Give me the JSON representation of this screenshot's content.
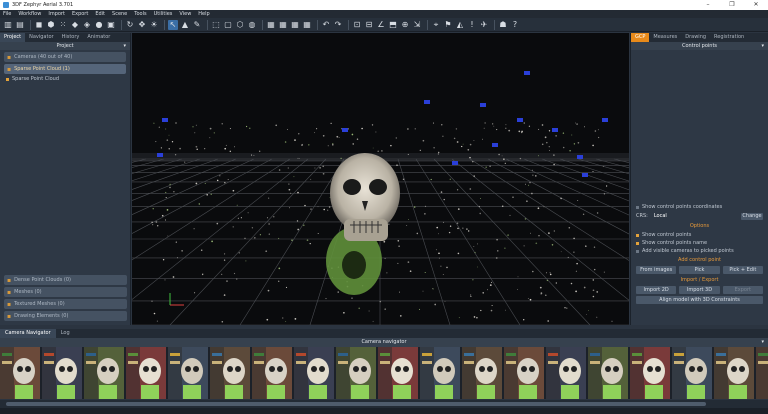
{
  "window": {
    "title": "3DF Zephyr Aerial 3.701",
    "controls": [
      "–",
      "❐",
      "✕"
    ]
  },
  "menu": [
    "File",
    "Workflow",
    "Import",
    "Export",
    "Edit",
    "Scene",
    "Tools",
    "Utilities",
    "View",
    "Help"
  ],
  "toolbar_icons": [
    {
      "name": "open-icon",
      "glyph": "▥"
    },
    {
      "name": "save-icon",
      "glyph": "▤"
    },
    {
      "name": "cube-solid-icon",
      "glyph": "◼"
    },
    {
      "name": "cube-wire-icon",
      "glyph": "⬢"
    },
    {
      "name": "points-icon",
      "glyph": "⁙"
    },
    {
      "name": "mesh-icon",
      "glyph": "◆"
    },
    {
      "name": "textured-icon",
      "glyph": "◈"
    },
    {
      "name": "sphere-icon",
      "glyph": "●"
    },
    {
      "name": "camera-icon",
      "glyph": "▣"
    },
    {
      "name": "orbit-icon",
      "glyph": "↻"
    },
    {
      "name": "pan-icon",
      "glyph": "✥"
    },
    {
      "name": "light-icon",
      "glyph": "☀"
    },
    {
      "name": "select-icon",
      "glyph": "↖"
    },
    {
      "name": "triangle-icon",
      "glyph": "▲"
    },
    {
      "name": "paint-icon",
      "glyph": "✎"
    },
    {
      "name": "lasso-icon",
      "glyph": "⬚"
    },
    {
      "name": "box-select-icon",
      "glyph": "▢"
    },
    {
      "name": "cube-icon",
      "glyph": "⬡"
    },
    {
      "name": "sphere2-icon",
      "glyph": "◍"
    },
    {
      "name": "grid1-icon",
      "glyph": "▦"
    },
    {
      "name": "grid2-icon",
      "glyph": "▦"
    },
    {
      "name": "grid3-icon",
      "glyph": "▦"
    },
    {
      "name": "grid4-icon",
      "glyph": "▦"
    },
    {
      "name": "undo-icon",
      "glyph": "↶"
    },
    {
      "name": "redo-icon",
      "glyph": "↷"
    },
    {
      "name": "measure-icon",
      "glyph": "⊡"
    },
    {
      "name": "ruler-icon",
      "glyph": "⊟"
    },
    {
      "name": "angle-icon",
      "glyph": "∠"
    },
    {
      "name": "area-icon",
      "glyph": "⬒"
    },
    {
      "name": "gcp-icon",
      "glyph": "⊕"
    },
    {
      "name": "scale-icon",
      "glyph": "⇲"
    },
    {
      "name": "tower-icon",
      "glyph": "⌖"
    },
    {
      "name": "flag-icon",
      "glyph": "⚑"
    },
    {
      "name": "cone-icon",
      "glyph": "◭"
    },
    {
      "name": "exclaim-icon",
      "glyph": "!"
    },
    {
      "name": "drone-icon",
      "glyph": "✈"
    },
    {
      "name": "mask-icon",
      "glyph": "☗"
    },
    {
      "name": "help-icon",
      "glyph": "?"
    }
  ],
  "left_panel": {
    "tabs": [
      "Project",
      "Navigator",
      "History",
      "Animator"
    ],
    "title": "Project",
    "cameras_button": "Cameras (40 out of 40)",
    "sparse_button": "Sparse Point Cloud (1)",
    "tree_item": "Sparse Point Cloud",
    "bottom_items": [
      "Dense Point Clouds (0)",
      "Meshes (0)",
      "Textured Meshes (0)",
      "Drawing Elements (0)"
    ]
  },
  "right_panel": {
    "tabs": [
      "GCP",
      "Measures",
      "Drawing",
      "Registration"
    ],
    "title": "Control points",
    "show_coords": "Show control points coordinates",
    "crs_label": "CRS:",
    "crs_value": "Local",
    "change": "Change",
    "options_title": "Options",
    "options": [
      "Show control points",
      "Show control points name",
      "Add visible cameras to picked points"
    ],
    "add_title": "Add control point",
    "add_buttons": [
      "From images",
      "Pick",
      "Pick + Edit"
    ],
    "import_title": "Import / Export",
    "import_buttons": [
      "Import 2D",
      "Import 3D",
      "Export"
    ],
    "align_button": "Align model with 3D Constraints"
  },
  "bottom": {
    "tabs": [
      "Camera Navigator",
      "Log"
    ],
    "navigator_title": "Camera navigator"
  },
  "colors": {
    "accent": "#e88a1a",
    "panel": "#2e3845",
    "viewport": "#0a0b0d",
    "points_white": "#d8d4cc",
    "points_green": "#8fd15a",
    "camera_blue": "#2a3fd8"
  }
}
